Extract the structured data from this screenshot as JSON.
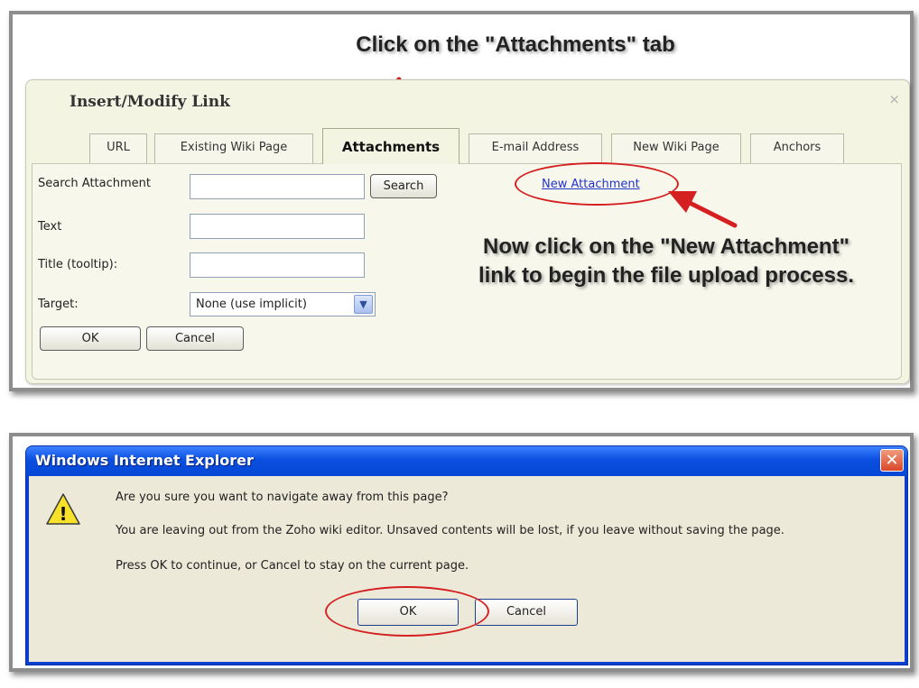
{
  "step1": {
    "instruction": "Click on the \"Attachments\" tab",
    "dialog": {
      "title": "Insert/Modify Link",
      "close": "×",
      "tabs": [
        {
          "label": "URL"
        },
        {
          "label": "Existing Wiki Page"
        },
        {
          "label": "Attachments",
          "active": true
        },
        {
          "label": "E-mail Address"
        },
        {
          "label": "New Wiki Page"
        },
        {
          "label": "Anchors"
        }
      ],
      "search_label": "Search Attachment",
      "search_value": "",
      "search_button": "Search",
      "text_label": "Text",
      "text_value": "",
      "tooltip_label": "Title (tooltip):",
      "tooltip_value": "",
      "target_label": "Target:",
      "target_value": "None (use implicit)",
      "ok_button": "OK",
      "cancel_button": "Cancel",
      "new_attachment_link": "New Attachment"
    },
    "note": "Now click on the \"New Attachment\" link to begin the file upload process."
  },
  "step2": {
    "window_title": "Windows Internet Explorer",
    "close": "✕",
    "messages": [
      "Are you sure you want to navigate away from this page?",
      "You are leaving out from the Zoho wiki editor. Unsaved contents will be lost, if you leave without saving the page.",
      "Press OK to continue, or Cancel to stay on the current page."
    ],
    "ok_button": "OK",
    "cancel_button": "Cancel",
    "warning_icon_glyph": "!"
  },
  "colors": {
    "annotation_red": "#d42020",
    "dialog_bg": "#f4f4e2",
    "ie_blue": "#0a4fe0",
    "link_blue": "#2233cc"
  }
}
